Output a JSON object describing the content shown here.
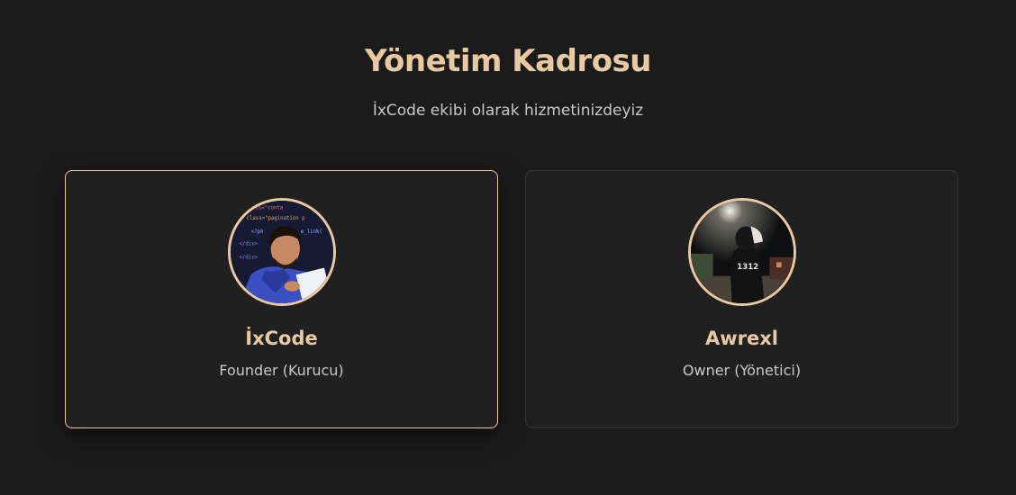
{
  "header": {
    "title": "Yönetim Kadrosu",
    "subtitle": "İxCode ekibi olarak hizmetinizdeyiz"
  },
  "team": [
    {
      "name": "İxCode",
      "role": "Founder (Kurucu)",
      "avatar_icon": "coder-portrait-illustration",
      "avatar_code_lines": [
        "class=\"conta",
        "div class=\"pagination p",
        "<?ph",
        "e_link(",
        "</div>",
        "</div>"
      ]
    },
    {
      "name": "Awrexl",
      "role": "Owner (Yönetici)",
      "avatar_icon": "hooded-person-night-photo",
      "avatar_jersey_number": "1312"
    }
  ],
  "colors": {
    "accent": "#e8c9a2",
    "background": "#1b1b1b",
    "card": "#202020",
    "muted_text": "#c8c8c8"
  }
}
